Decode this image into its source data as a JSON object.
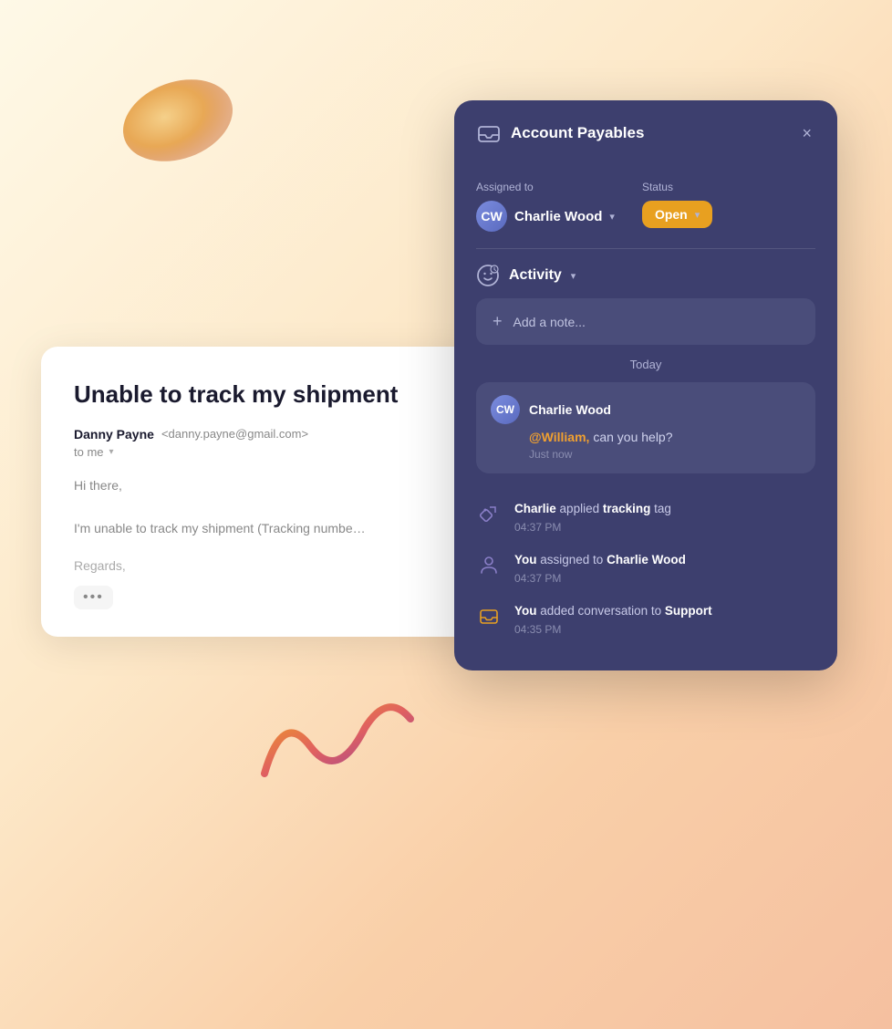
{
  "background": {
    "gradient_start": "#fef9e7",
    "gradient_end": "#f5c0a0"
  },
  "email_card": {
    "title": "Unable to track my shipment",
    "sender_name": "Danny Payne",
    "sender_email": "<danny.payne@gmail.com>",
    "to_label": "to me",
    "body_line1": "Hi there,",
    "body_line2": "I'm unable to track my shipment (Tracking numbe…",
    "regards": "Regards,",
    "more_dots": "•••"
  },
  "activity_panel": {
    "title": "Account Payables",
    "close_label": "×",
    "assigned_to_label": "Assigned to",
    "assignee_name": "Charlie Wood",
    "status_label": "Status",
    "status_value": "Open",
    "activity_label": "Activity",
    "add_note_placeholder": "Add a note...",
    "today_label": "Today",
    "chat": {
      "sender_name": "Charlie Wood",
      "mention": "@William,",
      "message_rest": " can you help?",
      "time": "Just now"
    },
    "log_items": [
      {
        "actor": "Charlie",
        "action": "applied",
        "highlight": "tracking",
        "suffix": "tag",
        "time": "04:37 PM",
        "icon": "tag"
      },
      {
        "actor": "You",
        "action": "assigned to",
        "highlight": "Charlie Wood",
        "suffix": "",
        "time": "04:37 PM",
        "icon": "person"
      },
      {
        "actor": "You",
        "action": "added conversation to",
        "highlight": "Support",
        "suffix": "",
        "time": "04:35 PM",
        "icon": "inbox"
      }
    ]
  }
}
